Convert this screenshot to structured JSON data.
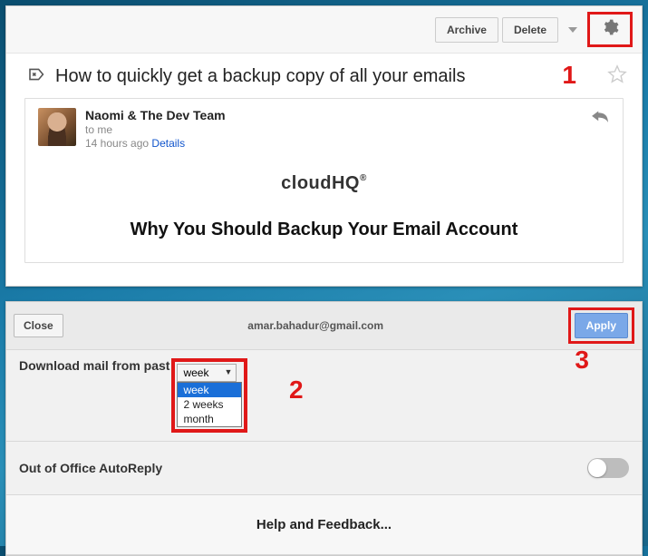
{
  "top": {
    "toolbar": {
      "archive": "Archive",
      "delete": "Delete"
    },
    "subject": "How to quickly get a backup copy of all your emails",
    "message": {
      "sender": "Naomi & The Dev Team",
      "to": "to me",
      "time": "14 hours ago",
      "details": "Details",
      "logo_part1": "cloud",
      "logo_part2": "HQ",
      "logo_mark": "®",
      "body_heading": "Why You Should Backup Your Email Account"
    },
    "annotation1": "1"
  },
  "bottom": {
    "close": "Close",
    "email": "amar.bahadur@gmail.com",
    "apply": "Apply",
    "download_label": "Download mail from past",
    "dropdown": {
      "selected": "week",
      "options": [
        "week",
        "2 weeks",
        "month"
      ]
    },
    "autoreply_label": "Out of Office AutoReply",
    "help": "Help and Feedback...",
    "annotation2": "2",
    "annotation3": "3"
  }
}
